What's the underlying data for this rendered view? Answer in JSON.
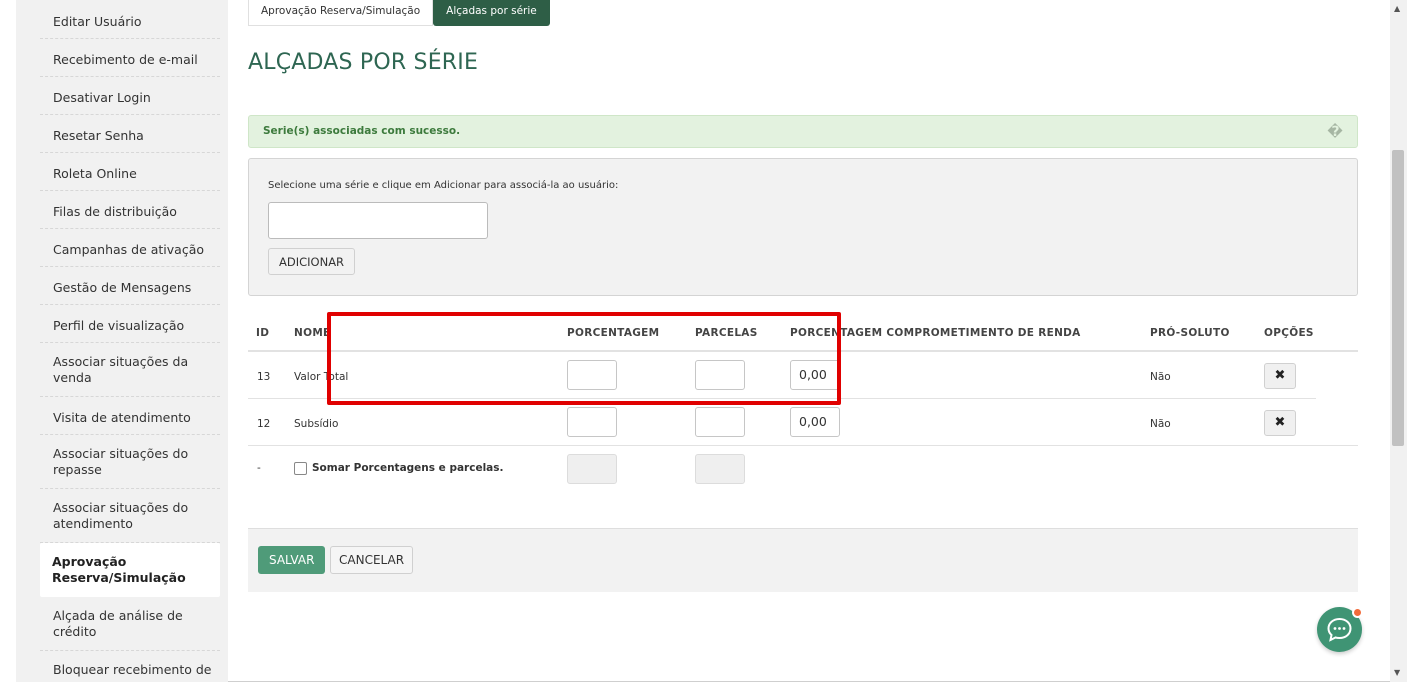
{
  "sidebar": {
    "items": [
      {
        "label": "Editar Usuário"
      },
      {
        "label": "Recebimento de e-mail"
      },
      {
        "label": "Desativar Login"
      },
      {
        "label": "Resetar Senha"
      },
      {
        "label": "Roleta Online"
      },
      {
        "label": "Filas de distribuição"
      },
      {
        "label": "Campanhas de ativação"
      },
      {
        "label": "Gestão de Mensagens"
      },
      {
        "label": "Perfil de visualização"
      },
      {
        "label": "Associar situações da venda"
      },
      {
        "label": "Visita de atendimento"
      },
      {
        "label": "Associar situações do repasse"
      },
      {
        "label": "Associar situações do atendimento"
      },
      {
        "label": "Aprovação Reserva/Simulação"
      },
      {
        "label": "Alçada de análise de crédito"
      },
      {
        "label": "Bloquear recebimento de"
      }
    ]
  },
  "tabs": [
    {
      "label": "Aprovação Reserva/Simulação"
    },
    {
      "label": "Alçadas por série"
    }
  ],
  "page": {
    "title": "ALÇADAS POR SÉRIE"
  },
  "alert": {
    "message": "Serie(s) associadas com sucesso.",
    "close_glyph": "�"
  },
  "form": {
    "hint": "Selecione uma série e clique em Adicionar para associá-la ao usuário:",
    "series_value": "",
    "add_label": "ADICIONAR"
  },
  "table": {
    "headers": {
      "id": "ID",
      "nome": "NOME",
      "porcentagem": "PORCENTAGEM",
      "parcelas": "PARCELAS",
      "comprometimento": "PORCENTAGEM COMPROMETIMENTO DE RENDA",
      "pro_soluto": "PRÓ-SOLUTO",
      "opcoes": "OPÇÕES"
    },
    "rows": [
      {
        "id": "13",
        "nome": "Valor Total",
        "porcentagem": "",
        "parcelas": "",
        "comprometimento": "0,00",
        "pro_soluto": "Não"
      },
      {
        "id": "12",
        "nome": "Subsídio",
        "porcentagem": "",
        "parcelas": "",
        "comprometimento": "0,00",
        "pro_soluto": "Não"
      }
    ],
    "sum_row": {
      "id": "-",
      "label": "Somar Porcentagens e parcelas."
    }
  },
  "footer": {
    "save_label": "SALVAR",
    "cancel_label": "CANCELAR"
  },
  "colors": {
    "accent": "#2e5e46",
    "save": "#4f9b79",
    "highlight": "#e00000",
    "chat": "#3f9474",
    "notification": "#f26b3a"
  }
}
